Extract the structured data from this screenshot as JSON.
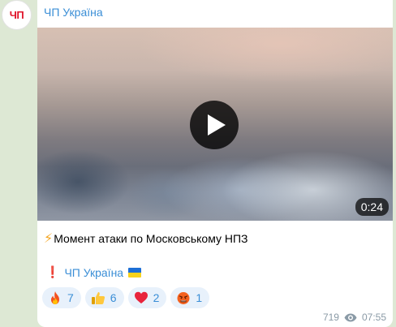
{
  "channel": {
    "avatar_text": "ЧП",
    "name": "ЧП Україна"
  },
  "video": {
    "duration": "0:24"
  },
  "message": {
    "caption_emoji": "⚡",
    "caption": "Момент атаки по Московському НПЗ",
    "signature_emoji": "❗",
    "signature": "ЧП Україна",
    "signature_flag": "ukraine-flag"
  },
  "reactions": [
    {
      "icon": "fire-icon",
      "count": "7"
    },
    {
      "icon": "thumbs-up-icon",
      "count": "6"
    },
    {
      "icon": "heart-icon",
      "count": "2"
    },
    {
      "icon": "angry-face-icon",
      "count": "1"
    }
  ],
  "meta": {
    "views": "719",
    "time": "07:55"
  },
  "colors": {
    "link": "#3a8ed6",
    "background": "#dde8d4",
    "reaction_bg": "#e8f1fb",
    "accent_red": "#e0162b"
  }
}
